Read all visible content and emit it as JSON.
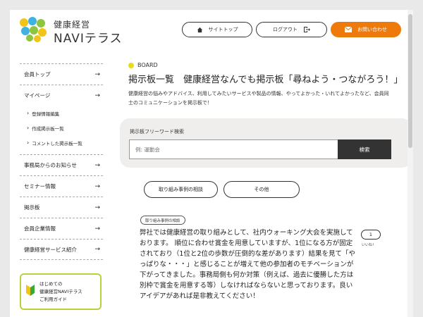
{
  "header": {
    "logo_line1": "健康経営",
    "logo_line2": "NAVIテラス",
    "site_top": "サイトトップ",
    "logout": "ログアウト",
    "contact": "お問い合わせ"
  },
  "sidebar": {
    "items": [
      {
        "label": "会員トップ",
        "arrow": "→"
      },
      {
        "label": "マイページ",
        "arrow": "→"
      }
    ],
    "subitems": [
      "登録情報編集",
      "作成掲示板一覧",
      "コメントした掲示板一覧"
    ],
    "items2": [
      {
        "label": "事務局からのお知らせ",
        "arrow": "→"
      },
      {
        "label": "セミナー情報",
        "arrow": "→"
      },
      {
        "label": "掲示板",
        "arrow": "→"
      },
      {
        "label": "会員企業情報",
        "arrow": "→"
      },
      {
        "label": "健康経営サービス紹介",
        "arrow": "→"
      }
    ],
    "guide": [
      "はじめての",
      "健康経営NAVIテラス",
      "ご利用ガイド"
    ]
  },
  "main": {
    "board_tag": "BOARD",
    "title": "掲示板一覧　健康経営なんでも掲示板「尋ねよう・つながろう！」",
    "intro": "健康経営の悩みやアドバイス、利用してみたいサービスや製品の情報、やってよかった・いれてよかったなど、会員同士のコミュニケーションを掲示板で！",
    "search_label": "掲示板フリーワード検索",
    "search_placeholder": "例: 運動会",
    "search_button": "検索",
    "filters": [
      "取り組み事例の相談",
      "その他"
    ],
    "post": {
      "category": "取り組み事例の相談",
      "text": "弊社では健康経営の取り組みとして、社内ウォーキング大会を実施しております。 順位に合わせ賞金を用意していますが、1位になる方が固定されており（1位と2位の歩数が圧倒的な差があります）結果を見て「やっぱりな・・・」と感じることが増えて他の参加者のモチベーションが下がってきました。事務局側も何か対策（例えば、過去に優勝した方は別枠で賞金を用意する等）しなければならないと思っております。良いアイデアがあれば是非教えてください！",
      "likes": "1",
      "like_label": "いいね！"
    }
  },
  "colors": {
    "accent": "#ef7a0c",
    "green": "#b5d33a",
    "yellow_dot": "#e6dc1d"
  }
}
